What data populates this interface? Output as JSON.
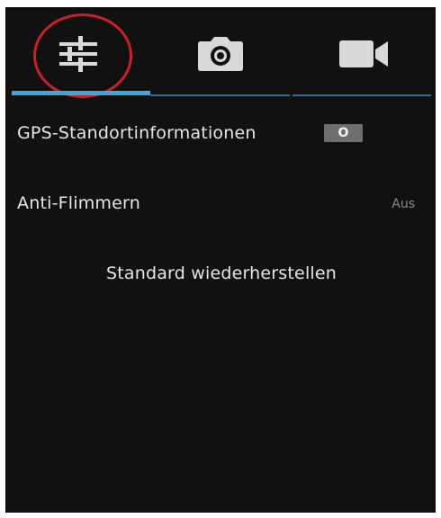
{
  "tabs": {
    "settings": {
      "icon": "sliders-icon",
      "active": true
    },
    "photo": {
      "icon": "camera-icon"
    },
    "video": {
      "icon": "video-camera-icon"
    }
  },
  "colors": {
    "background": "#111111",
    "accent": "#3ea6dc",
    "annotation_circle": "#c9202a",
    "toggle_bg": "#6e6e6e",
    "text": "#e6e6e6",
    "muted_text": "#8a8a8a"
  },
  "settings": {
    "gps": {
      "label": "GPS-Standortinformationen",
      "toggle_text": "O"
    },
    "anti_flicker": {
      "label": "Anti-Flimmern",
      "value": "Aus"
    },
    "reset": {
      "label": "Standard wiederherstellen"
    }
  }
}
